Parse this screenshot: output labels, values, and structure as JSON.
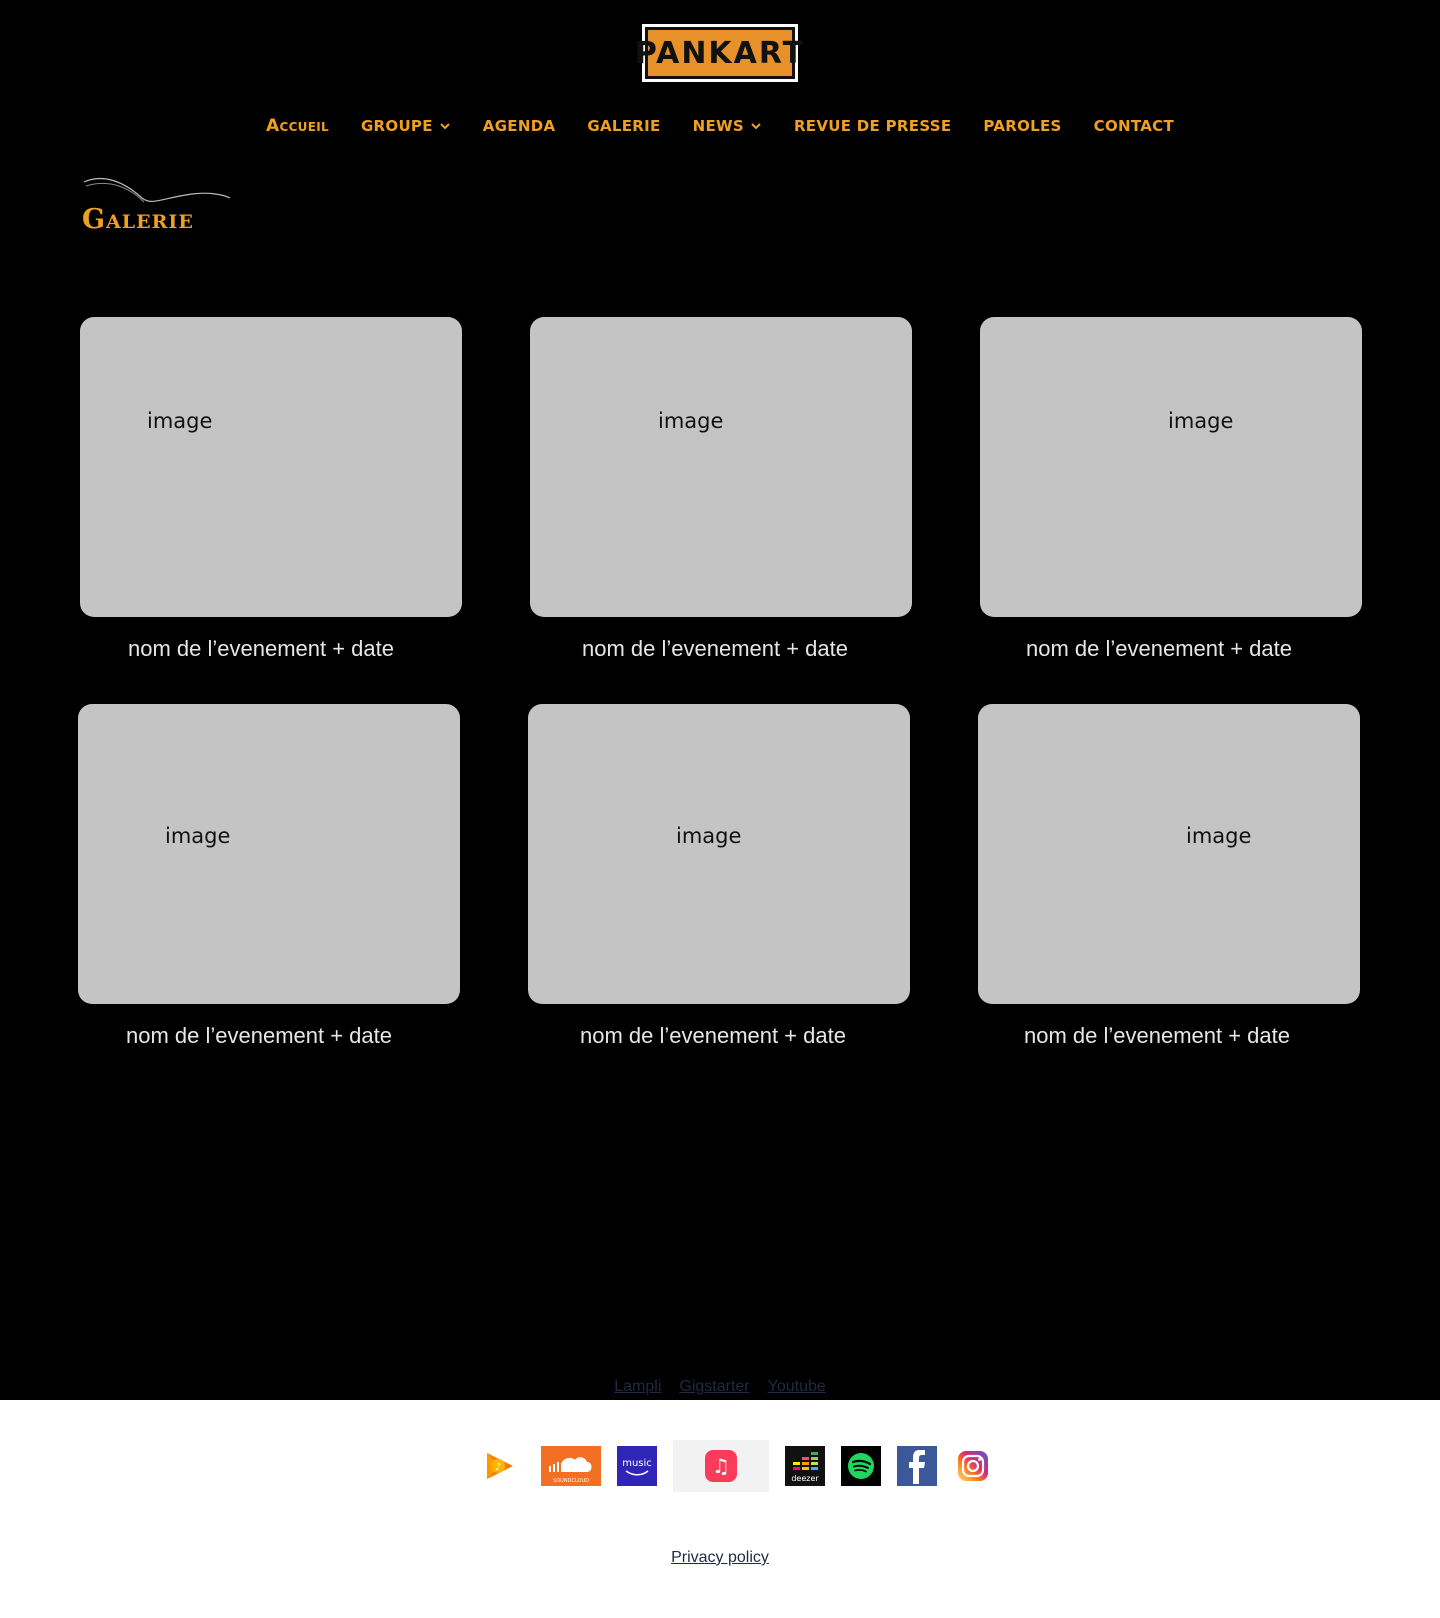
{
  "logo": {
    "text": "PANKART"
  },
  "nav": {
    "items": [
      {
        "label": "Accueil",
        "has_dropdown": false
      },
      {
        "label": "GROUPE",
        "has_dropdown": true
      },
      {
        "label": "AGENDA",
        "has_dropdown": false
      },
      {
        "label": "GALERIE",
        "has_dropdown": false
      },
      {
        "label": "NEWS",
        "has_dropdown": true
      },
      {
        "label": "REVUE DE PRESSE",
        "has_dropdown": false
      },
      {
        "label": "PAROLES",
        "has_dropdown": false
      },
      {
        "label": "CONTACT",
        "has_dropdown": false
      }
    ]
  },
  "page": {
    "title": "Galerie"
  },
  "gallery": {
    "items": [
      {
        "image_label": "image",
        "caption": "nom de l’evenement + date"
      },
      {
        "image_label": "image",
        "caption": "nom de l’evenement + date"
      },
      {
        "image_label": "image",
        "caption": "nom de l’evenement + date"
      },
      {
        "image_label": "image",
        "caption": "nom de l’evenement + date"
      },
      {
        "image_label": "image",
        "caption": "nom de l’evenement + date"
      },
      {
        "image_label": "image",
        "caption": "nom de l’evenement + date"
      }
    ]
  },
  "footer": {
    "links": [
      "Lampli",
      "Gigstarter",
      "Youtube"
    ],
    "icons": [
      {
        "name": "google-play-music-icon"
      },
      {
        "name": "soundcloud-icon",
        "text": "SOUNDCLOUD"
      },
      {
        "name": "amazon-music-icon",
        "text": "music"
      },
      {
        "name": "apple-music-icon"
      },
      {
        "name": "deezer-icon",
        "text": "deezer"
      },
      {
        "name": "spotify-icon"
      },
      {
        "name": "facebook-icon"
      },
      {
        "name": "instagram-icon"
      }
    ],
    "privacy": "Privacy policy"
  },
  "colors": {
    "accent": "#f0a021",
    "background": "#000000",
    "card": "#c4c4c4",
    "caption": "#e6e6e6",
    "footer_link": "#1f2a44"
  }
}
